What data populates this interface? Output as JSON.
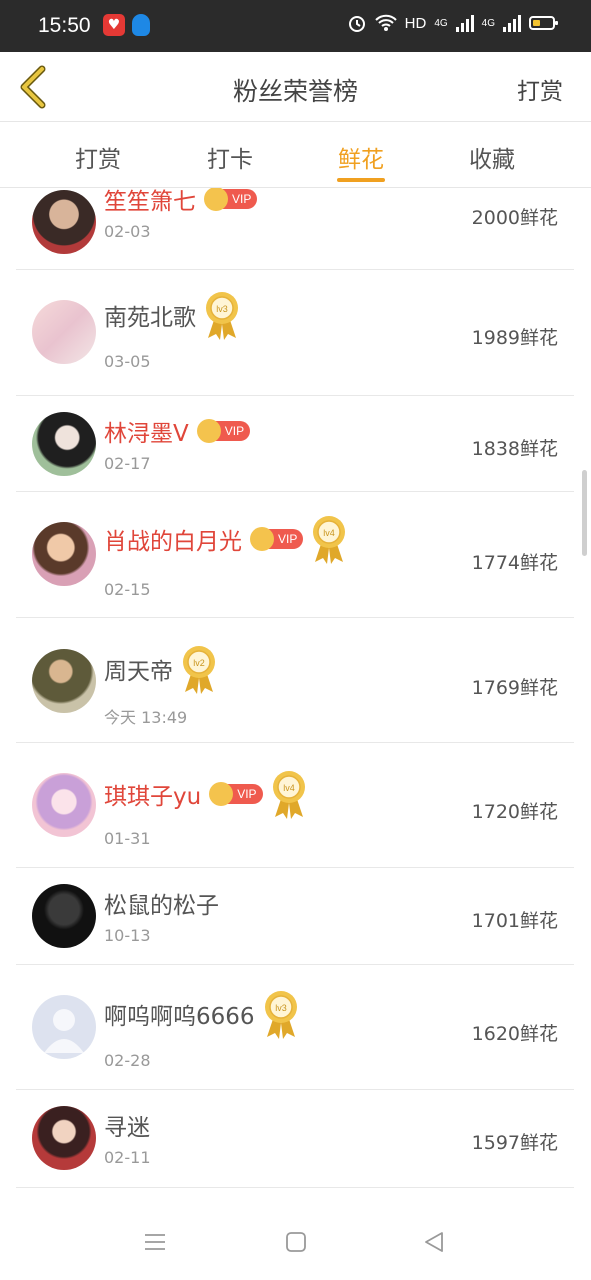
{
  "status_bar": {
    "time": "15:50",
    "hd_label": "HD",
    "net1": "4G",
    "net2": "4G"
  },
  "header": {
    "back_icon": "chevron-left-icon",
    "title": "粉丝荣誉榜",
    "action": "打赏"
  },
  "tabs": [
    {
      "label": "打赏",
      "active": false
    },
    {
      "label": "打卡",
      "active": false
    },
    {
      "label": "鲜花",
      "active": true
    },
    {
      "label": "收藏",
      "active": false
    }
  ],
  "rows": [
    {
      "name": "笙笙箫七",
      "vip": true,
      "vip_label": "VIP",
      "medal": "",
      "date": "02-03",
      "amount": "2000鲜花"
    },
    {
      "name": "南苑北歌",
      "vip": false,
      "medal": "lv3",
      "date": "03-05",
      "amount": "1989鲜花"
    },
    {
      "name": "林浔墨V",
      "vip": true,
      "vip_label": "VIP",
      "medal": "",
      "date": "02-17",
      "amount": "1838鲜花"
    },
    {
      "name": "肖战的白月光",
      "vip": true,
      "vip_label": "VIP",
      "medal": "lv4",
      "date": "02-15",
      "amount": "1774鲜花"
    },
    {
      "name": "周天帝",
      "vip": false,
      "medal": "lv2",
      "date": "今天 13:49",
      "amount": "1769鲜花"
    },
    {
      "name": "琪琪子yu",
      "vip": true,
      "vip_label": "VIP",
      "medal": "lv4",
      "date": "01-31",
      "amount": "1720鲜花"
    },
    {
      "name": "松鼠的松子",
      "vip": false,
      "medal": "",
      "date": "10-13",
      "amount": "1701鲜花"
    },
    {
      "name": "啊呜啊呜6666",
      "vip": false,
      "medal": "lv3",
      "date": "02-28",
      "amount": "1620鲜花"
    },
    {
      "name": "寻迷",
      "vip": false,
      "medal": "",
      "date": "02-11",
      "amount": "1597鲜花"
    }
  ],
  "colors": {
    "accent": "#f0a020",
    "vip_name": "#e0463a",
    "vip_badge": "#ef5a4e",
    "status_bar": "#2b2b2b"
  },
  "system_nav": [
    "menu-icon",
    "home-square-icon",
    "back-triangle-icon"
  ]
}
